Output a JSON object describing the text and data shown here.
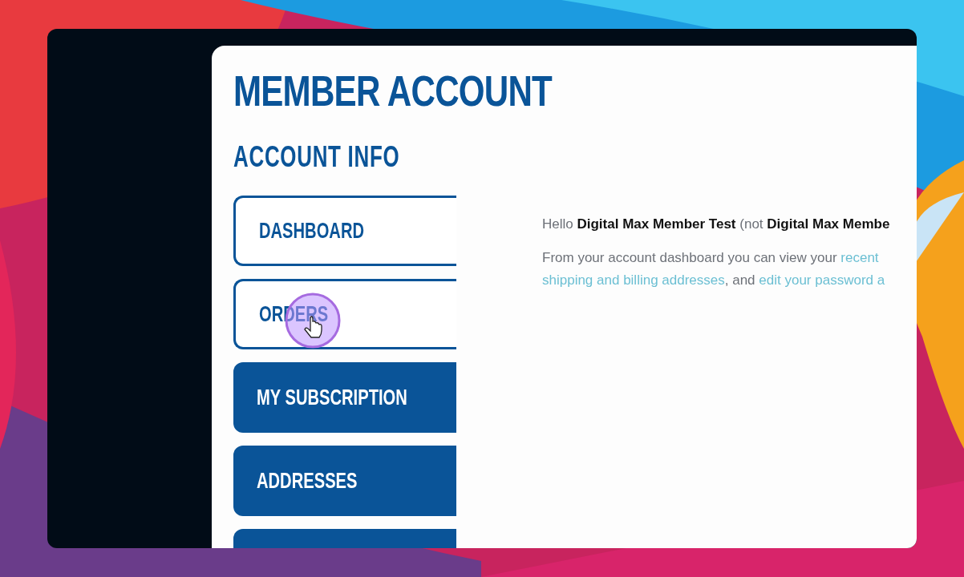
{
  "page": {
    "title": "MEMBER ACCOUNT",
    "subtitle": "ACCOUNT INFO"
  },
  "nav": [
    {
      "kind": "outline",
      "label": "DASHBOARD"
    },
    {
      "kind": "outline",
      "label": "ORDERS"
    },
    {
      "kind": "solid",
      "label": "MY SUBSCRIPTION"
    },
    {
      "kind": "solid",
      "label": "ADDRESSES"
    },
    {
      "kind": "solid"
    }
  ],
  "greeting": "Hello **Digital Max Member Test** (not **Digital Max Membe**",
  "intro": [
    {
      "kind": "text",
      "text": "From your account dashboard you can view your "
    },
    {
      "kind": "link",
      "text": "recent"
    },
    {
      "kind": "break"
    },
    {
      "kind": "link",
      "text": "shipping and billing addresses"
    },
    {
      "kind": "text",
      "text": ", and "
    },
    {
      "kind": "link",
      "text": "edit your password a"
    }
  ]
}
